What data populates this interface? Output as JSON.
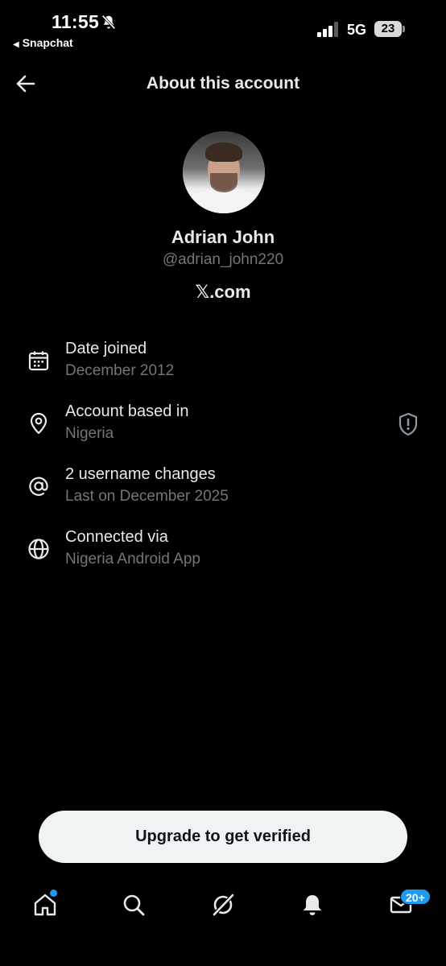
{
  "status_bar": {
    "time": "11:55",
    "back_app": "Snapchat",
    "network": "5G",
    "battery": "23",
    "signal_bars_active": 3
  },
  "header": {
    "title": "About this account"
  },
  "profile": {
    "display_name": "Adrian John",
    "handle": "@adrian_john220",
    "domain_mark": "𝕏",
    "domain_suffix": ".com"
  },
  "info": [
    {
      "icon": "calendar-icon",
      "title": "Date joined",
      "subtitle": "December 2012"
    },
    {
      "icon": "location-pin-icon",
      "title": "Account based in",
      "subtitle": "Nigeria",
      "trailing_icon": "shield-alert-icon"
    },
    {
      "icon": "at-sign-icon",
      "title": "2 username changes",
      "subtitle": "Last on December 2025"
    },
    {
      "icon": "globe-icon",
      "title": "Connected via",
      "subtitle": "Nigeria Android App"
    }
  ],
  "upgrade_button": "Upgrade to get verified",
  "bottom_nav": {
    "items": [
      "home-icon",
      "search-icon",
      "grok-icon",
      "notifications-icon",
      "messages-icon"
    ],
    "messages_badge": "20+"
  },
  "colors": {
    "background": "#000000",
    "primary_text": "#e7e9ea",
    "secondary_text": "#71767b",
    "accent": "#1d9bf0",
    "button_bg": "#eff3f4"
  }
}
